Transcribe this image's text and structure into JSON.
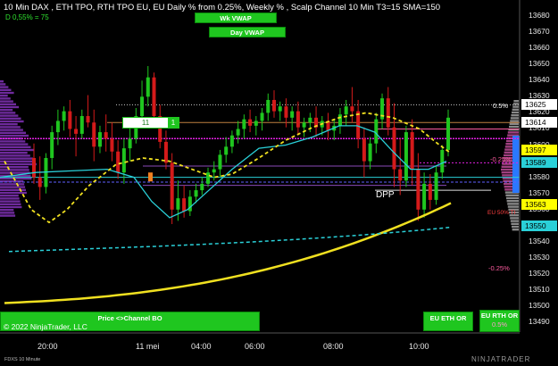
{
  "header": {
    "title": "10 Min DAX , ETH TPO, RTH TPO EU, EU Daily % from 0.25%, Weekly % , Scalp Channel 10 Min  T3=15 SMA=150",
    "subtitle": "D 0,55% = 75"
  },
  "buttons": {
    "wk_vwap": "Wk VWAP",
    "day_vwap": "Day VWAP",
    "price_channel": "Price <>Channel BO",
    "eu_eth_or": "EU ETH OR",
    "eu_rth_or": "EU RTH OR",
    "eu_rth_or_pct": "0.5%"
  },
  "order_widget": {
    "quantity": "11",
    "button": "1"
  },
  "annotations": {
    "dpp": "DPP",
    "pct_upper": "0.5%",
    "pct_mid": "-0.25%",
    "pct_low": "-0.25%",
    "eu_label": "EU 50% TI"
  },
  "copyright": "© 2022 NinjaTrader, LLC",
  "footer": {
    "instrument": "FDXS 10 Minute",
    "brand": "NINJATRADER"
  },
  "colors": {
    "up_candle": "#1fc61f",
    "down_candle": "#d41a1a",
    "vwap_wk": "#f0e020",
    "vwap_day": "#2ad0d8",
    "t3": "#f0e020",
    "tpo": "#7a2ea8",
    "magenta": "#e020e0"
  },
  "price_boxes": [
    {
      "label": "13625",
      "bg": "#ffffff",
      "fg": "#000000"
    },
    {
      "label": "13614",
      "bg": "#ffffff",
      "fg": "#000000"
    },
    {
      "label": "13597",
      "bg": "#ffff00",
      "fg": "#000000"
    },
    {
      "label": "13589",
      "bg": "#2ad0d8",
      "fg": "#000000"
    },
    {
      "label": "13563",
      "bg": "#ffff00",
      "fg": "#000000"
    },
    {
      "label": "13550",
      "bg": "#2ad0d8",
      "fg": "#000000"
    }
  ],
  "chart_data": {
    "type": "candlestick",
    "y_axis_ticks": [
      "13680",
      "13670",
      "13660",
      "13650",
      "13640",
      "13630",
      "13620",
      "13610",
      "13600",
      "13590",
      "13580",
      "13570",
      "13560",
      "13550",
      "13540",
      "13530",
      "13520",
      "13510",
      "13500",
      "13490"
    ],
    "x_axis_ticks": [
      "20:00",
      "11 mei",
      "04:00",
      "06:00",
      "08:00",
      "10:00"
    ],
    "ylim": [
      13484,
      13690
    ],
    "candles": [
      {
        "o": 13592,
        "h": 13601,
        "c": 13580,
        "l": 13576
      },
      {
        "o": 13580,
        "h": 13593,
        "c": 13574,
        "l": 13566
      },
      {
        "o": 13574,
        "h": 13595,
        "c": 13592,
        "l": 13570
      },
      {
        "o": 13592,
        "h": 13612,
        "c": 13608,
        "l": 13585
      },
      {
        "o": 13608,
        "h": 13622,
        "c": 13615,
        "l": 13600
      },
      {
        "o": 13615,
        "h": 13624,
        "c": 13621,
        "l": 13609
      },
      {
        "o": 13621,
        "h": 13628,
        "c": 13610,
        "l": 13605
      },
      {
        "o": 13610,
        "h": 13618,
        "c": 13607,
        "l": 13593
      },
      {
        "o": 13607,
        "h": 13622,
        "c": 13618,
        "l": 13604
      },
      {
        "o": 13618,
        "h": 13631,
        "c": 13614,
        "l": 13611
      },
      {
        "o": 13614,
        "h": 13622,
        "c": 13599,
        "l": 13590
      },
      {
        "o": 13599,
        "h": 13612,
        "c": 13608,
        "l": 13595
      },
      {
        "o": 13608,
        "h": 13619,
        "c": 13604,
        "l": 13596
      },
      {
        "o": 13604,
        "h": 13614,
        "c": 13596,
        "l": 13590
      },
      {
        "o": 13596,
        "h": 13603,
        "c": 13583,
        "l": 13579
      },
      {
        "o": 13583,
        "h": 13604,
        "c": 13598,
        "l": 13576
      },
      {
        "o": 13598,
        "h": 13611,
        "c": 13604,
        "l": 13590
      },
      {
        "o": 13604,
        "h": 13623,
        "c": 13618,
        "l": 13601
      },
      {
        "o": 13618,
        "h": 13640,
        "c": 13630,
        "l": 13613
      },
      {
        "o": 13630,
        "h": 13649,
        "c": 13642,
        "l": 13624
      },
      {
        "o": 13642,
        "h": 13645,
        "c": 13618,
        "l": 13611
      },
      {
        "o": 13618,
        "h": 13625,
        "c": 13602,
        "l": 13598
      },
      {
        "o": 13602,
        "h": 13609,
        "c": 13589,
        "l": 13585
      },
      {
        "o": 13589,
        "h": 13595,
        "c": 13560,
        "l": 13551
      },
      {
        "o": 13560,
        "h": 13578,
        "c": 13567,
        "l": 13553
      },
      {
        "o": 13567,
        "h": 13575,
        "c": 13559,
        "l": 13555
      },
      {
        "o": 13559,
        "h": 13572,
        "c": 13568,
        "l": 13556
      },
      {
        "o": 13568,
        "h": 13576,
        "c": 13572,
        "l": 13564
      },
      {
        "o": 13572,
        "h": 13580,
        "c": 13576,
        "l": 13569
      },
      {
        "o": 13576,
        "h": 13586,
        "c": 13583,
        "l": 13574
      },
      {
        "o": 13583,
        "h": 13590,
        "c": 13585,
        "l": 13578
      },
      {
        "o": 13585,
        "h": 13597,
        "c": 13594,
        "l": 13580
      },
      {
        "o": 13594,
        "h": 13605,
        "c": 13599,
        "l": 13589
      },
      {
        "o": 13599,
        "h": 13609,
        "c": 13606,
        "l": 13595
      },
      {
        "o": 13606,
        "h": 13615,
        "c": 13610,
        "l": 13601
      },
      {
        "o": 13610,
        "h": 13619,
        "c": 13616,
        "l": 13604
      },
      {
        "o": 13616,
        "h": 13622,
        "c": 13612,
        "l": 13608
      },
      {
        "o": 13612,
        "h": 13618,
        "c": 13615,
        "l": 13606
      },
      {
        "o": 13615,
        "h": 13623,
        "c": 13620,
        "l": 13609
      },
      {
        "o": 13620,
        "h": 13632,
        "c": 13628,
        "l": 13615
      },
      {
        "o": 13628,
        "h": 13634,
        "c": 13621,
        "l": 13617
      },
      {
        "o": 13621,
        "h": 13627,
        "c": 13624,
        "l": 13615
      },
      {
        "o": 13624,
        "h": 13629,
        "c": 13617,
        "l": 13611
      },
      {
        "o": 13617,
        "h": 13624,
        "c": 13621,
        "l": 13609
      },
      {
        "o": 13621,
        "h": 13627,
        "c": 13611,
        "l": 13606
      },
      {
        "o": 13611,
        "h": 13617,
        "c": 13614,
        "l": 13605
      },
      {
        "o": 13614,
        "h": 13620,
        "c": 13617,
        "l": 13608
      },
      {
        "o": 13617,
        "h": 13624,
        "c": 13611,
        "l": 13605
      },
      {
        "o": 13611,
        "h": 13618,
        "c": 13615,
        "l": 13606
      },
      {
        "o": 13615,
        "h": 13620,
        "c": 13609,
        "l": 13603
      },
      {
        "o": 13609,
        "h": 13616,
        "c": 13612,
        "l": 13603
      },
      {
        "o": 13612,
        "h": 13623,
        "c": 13619,
        "l": 13607
      },
      {
        "o": 13619,
        "h": 13628,
        "c": 13624,
        "l": 13612
      },
      {
        "o": 13624,
        "h": 13636,
        "c": 13621,
        "l": 13614
      },
      {
        "o": 13621,
        "h": 13628,
        "c": 13604,
        "l": 13598
      },
      {
        "o": 13604,
        "h": 13611,
        "c": 13590,
        "l": 13580
      },
      {
        "o": 13590,
        "h": 13605,
        "c": 13601,
        "l": 13585
      },
      {
        "o": 13601,
        "h": 13620,
        "c": 13616,
        "l": 13595
      },
      {
        "o": 13616,
        "h": 13632,
        "c": 13629,
        "l": 13610
      },
      {
        "o": 13629,
        "h": 13636,
        "c": 13611,
        "l": 13606
      },
      {
        "o": 13611,
        "h": 13626,
        "c": 13585,
        "l": 13574
      },
      {
        "o": 13585,
        "h": 13604,
        "c": 13578,
        "l": 13569
      },
      {
        "o": 13578,
        "h": 13612,
        "c": 13608,
        "l": 13574
      },
      {
        "o": 13608,
        "h": 13616,
        "c": 13585,
        "l": 13575
      },
      {
        "o": 13585,
        "h": 13595,
        "c": 13560,
        "l": 13553
      },
      {
        "o": 13560,
        "h": 13583,
        "c": 13576,
        "l": 13555
      },
      {
        "o": 13576,
        "h": 13582,
        "c": 13566,
        "l": 13560
      },
      {
        "o": 13566,
        "h": 13587,
        "c": 13583,
        "l": 13563
      },
      {
        "o": 13583,
        "h": 13600,
        "c": 13597,
        "l": 13579
      },
      {
        "o": 13597,
        "h": 13622,
        "c": 13617,
        "l": 13593
      }
    ],
    "series": [
      {
        "name": "Wk VWAP"
      },
      {
        "name": "Day VWAP"
      }
    ]
  }
}
